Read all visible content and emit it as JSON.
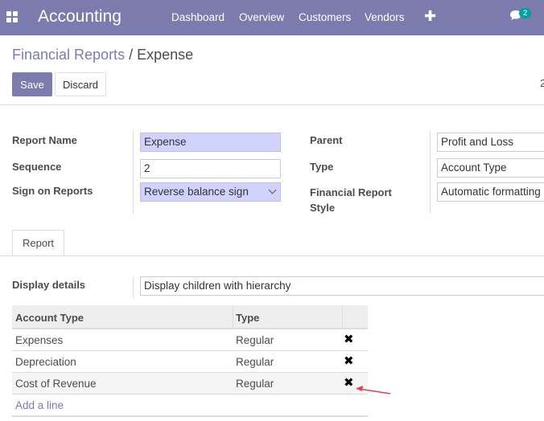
{
  "navbar": {
    "brand": "Accounting",
    "menu": [
      "Dashboard",
      "Overview",
      "Customers",
      "Vendors"
    ],
    "plus": "✚",
    "chat_badge": "2",
    "accent_color": "#7c7bad"
  },
  "breadcrumb": {
    "parent": "Financial Reports",
    "separator": "/",
    "current": "Expense"
  },
  "actions": {
    "save_label": "Save",
    "discard_label": "Discard",
    "pager_peek": "2"
  },
  "form": {
    "report_name_label": "Report Name",
    "report_name_value": "Expense",
    "sequence_label": "Sequence",
    "sequence_value": "2",
    "sign_label": "Sign on Reports",
    "sign_value": "Reverse balance sign",
    "parent_label": "Parent",
    "parent_value": "Profit and Loss",
    "type_label": "Type",
    "type_value": "Account Type",
    "style_label": "Financial Report Style",
    "style_value": "Automatic formatting"
  },
  "notebook": {
    "tab_label": "Report",
    "display_details_label": "Display details",
    "display_details_value": "Display children with hierarchy"
  },
  "table": {
    "columns": [
      "Account Type",
      "Type"
    ],
    "rows": [
      {
        "account_type": "Expenses",
        "type": "Regular"
      },
      {
        "account_type": "Depreciation",
        "type": "Regular"
      },
      {
        "account_type": "Cost of Revenue",
        "type": "Regular"
      }
    ],
    "delete_glyph": "✖",
    "add_line": "Add a line"
  }
}
